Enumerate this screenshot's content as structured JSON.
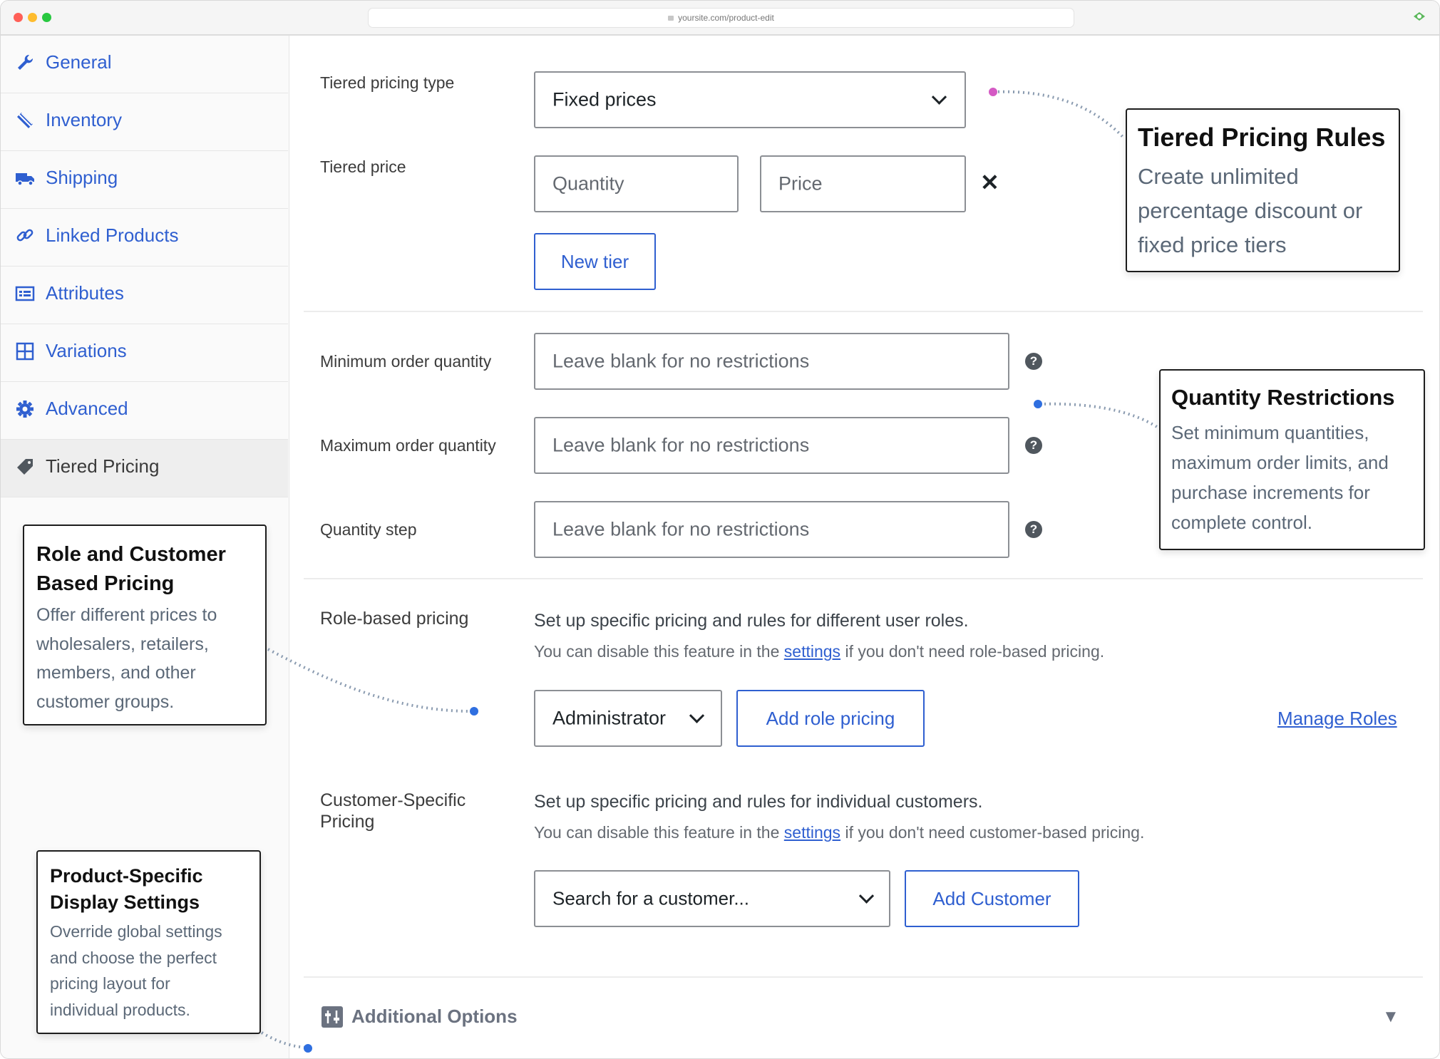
{
  "browser": {
    "url": "yoursite.com/product-edit",
    "traffic_lights": [
      "#ff5f57",
      "#febc2e",
      "#28c840"
    ]
  },
  "sidebar": {
    "items": [
      {
        "label": "General",
        "icon": "wrench-icon"
      },
      {
        "label": "Inventory",
        "icon": "tag-stack-icon"
      },
      {
        "label": "Shipping",
        "icon": "truck-icon"
      },
      {
        "label": "Linked Products",
        "icon": "link-icon"
      },
      {
        "label": "Attributes",
        "icon": "list-table-icon"
      },
      {
        "label": "Variations",
        "icon": "grid-icon"
      },
      {
        "label": "Advanced",
        "icon": "gear-icon"
      },
      {
        "label": "Tiered Pricing",
        "icon": "price-tag-icon",
        "active": true
      }
    ]
  },
  "tiered": {
    "type_label": "Tiered pricing type",
    "type_value": "Fixed prices",
    "price_label": "Tiered price",
    "quantity_placeholder": "Quantity",
    "price_placeholder": "Price",
    "remove_symbol": "✕",
    "new_tier_label": "New tier"
  },
  "quantity": {
    "min_label": "Minimum order quantity",
    "max_label": "Maximum order quantity",
    "step_label": "Quantity step",
    "placeholder": "Leave blank for no restrictions",
    "help_symbol": "?"
  },
  "role_pricing": {
    "label": "Role-based pricing",
    "description": "Set up specific pricing and rules for different user roles.",
    "note_before": "You can disable this feature in the",
    "note_link": "settings",
    "note_after": "if you don't need role-based pricing.",
    "role_value": "Administrator",
    "add_button": "Add role pricing",
    "manage_link": "Manage Roles"
  },
  "customer_pricing": {
    "label_line1": "Customer-Specific",
    "label_line2": "Pricing",
    "description": "Set up specific pricing and rules for individual customers.",
    "note_before": "You can disable this feature in the",
    "note_link": "settings",
    "note_after": "if you don't need customer-based pricing.",
    "search_value": "Search for a customer...",
    "add_button": "Add Customer"
  },
  "additional": {
    "label": "Additional Options",
    "toggle_symbol": "▼"
  },
  "callouts": {
    "tiered_rules": {
      "title": "Tiered Pricing Rules",
      "lines": [
        "Create unlimited",
        "percentage discount or",
        "fixed price tiers"
      ]
    },
    "quantity_restrictions": {
      "title": "Quantity Restrictions",
      "lines": [
        "Set minimum quantities,",
        "maximum order limits, and",
        "purchase increments for",
        "complete control."
      ]
    },
    "role_customer": {
      "title_lines": [
        "Role and Customer",
        "Based Pricing"
      ],
      "lines": [
        "Offer different prices to",
        "wholesalers, retailers,",
        "members, and other",
        "customer groups."
      ]
    },
    "display_settings": {
      "title_lines": [
        "Product-Specific",
        "Display Settings"
      ],
      "lines": [
        "Override global settings",
        "and choose the perfect",
        "pricing layout for",
        "individual products."
      ]
    }
  },
  "colors": {
    "accent": "#2f5fd0",
    "connector": "#8a9bb0",
    "dot_pink": "#d45ac4",
    "dot_blue": "#2f6fe0"
  }
}
